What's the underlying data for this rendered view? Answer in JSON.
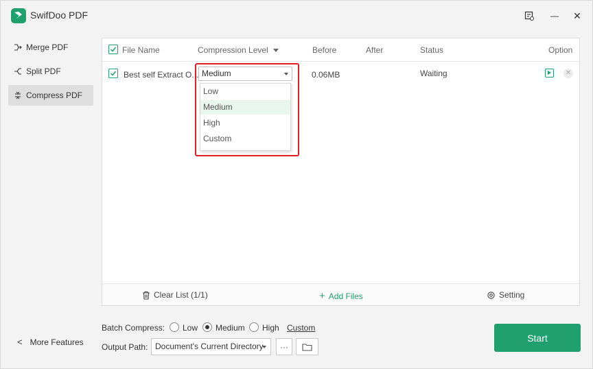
{
  "app": {
    "title": "SwifDoo PDF",
    "accent": "#1fa06e",
    "highlight_color": "#e02020"
  },
  "titlebar": {
    "icons": [
      "feedback-icon",
      "minimize-icon",
      "close-icon"
    ],
    "minimize_glyph": "—",
    "close_glyph": "✕"
  },
  "sidebar": {
    "items": [
      {
        "label": "Merge PDF",
        "icon": "merge-icon"
      },
      {
        "label": "Split PDF",
        "icon": "split-icon"
      },
      {
        "label": "Compress PDF",
        "icon": "compress-icon",
        "active": true
      }
    ],
    "more": {
      "chevron": "<",
      "label": "More Features"
    }
  },
  "table": {
    "headers": {
      "file_name": "File Name",
      "compression": "Compression Level",
      "before": "Before",
      "after": "After",
      "status": "Status",
      "option": "Option"
    },
    "rows": [
      {
        "file_name": "Best self Extract O...",
        "compression": "Medium",
        "before": "0.06MB",
        "after": "",
        "status": "Waiting"
      }
    ]
  },
  "dropdown": {
    "options": [
      "Low",
      "Medium",
      "High",
      "Custom"
    ],
    "selected": "Medium"
  },
  "footer": {
    "clear": "Clear List (1/1)",
    "add": "Add Files",
    "add_glyph": "+",
    "setting": "Setting"
  },
  "batch": {
    "label": "Batch Compress:",
    "options": [
      "Low",
      "Medium",
      "High"
    ],
    "selected": "Medium",
    "custom": "Custom"
  },
  "output": {
    "label": "Output Path:",
    "value": "Document's Current Directory",
    "more": "···"
  },
  "start": "Start"
}
